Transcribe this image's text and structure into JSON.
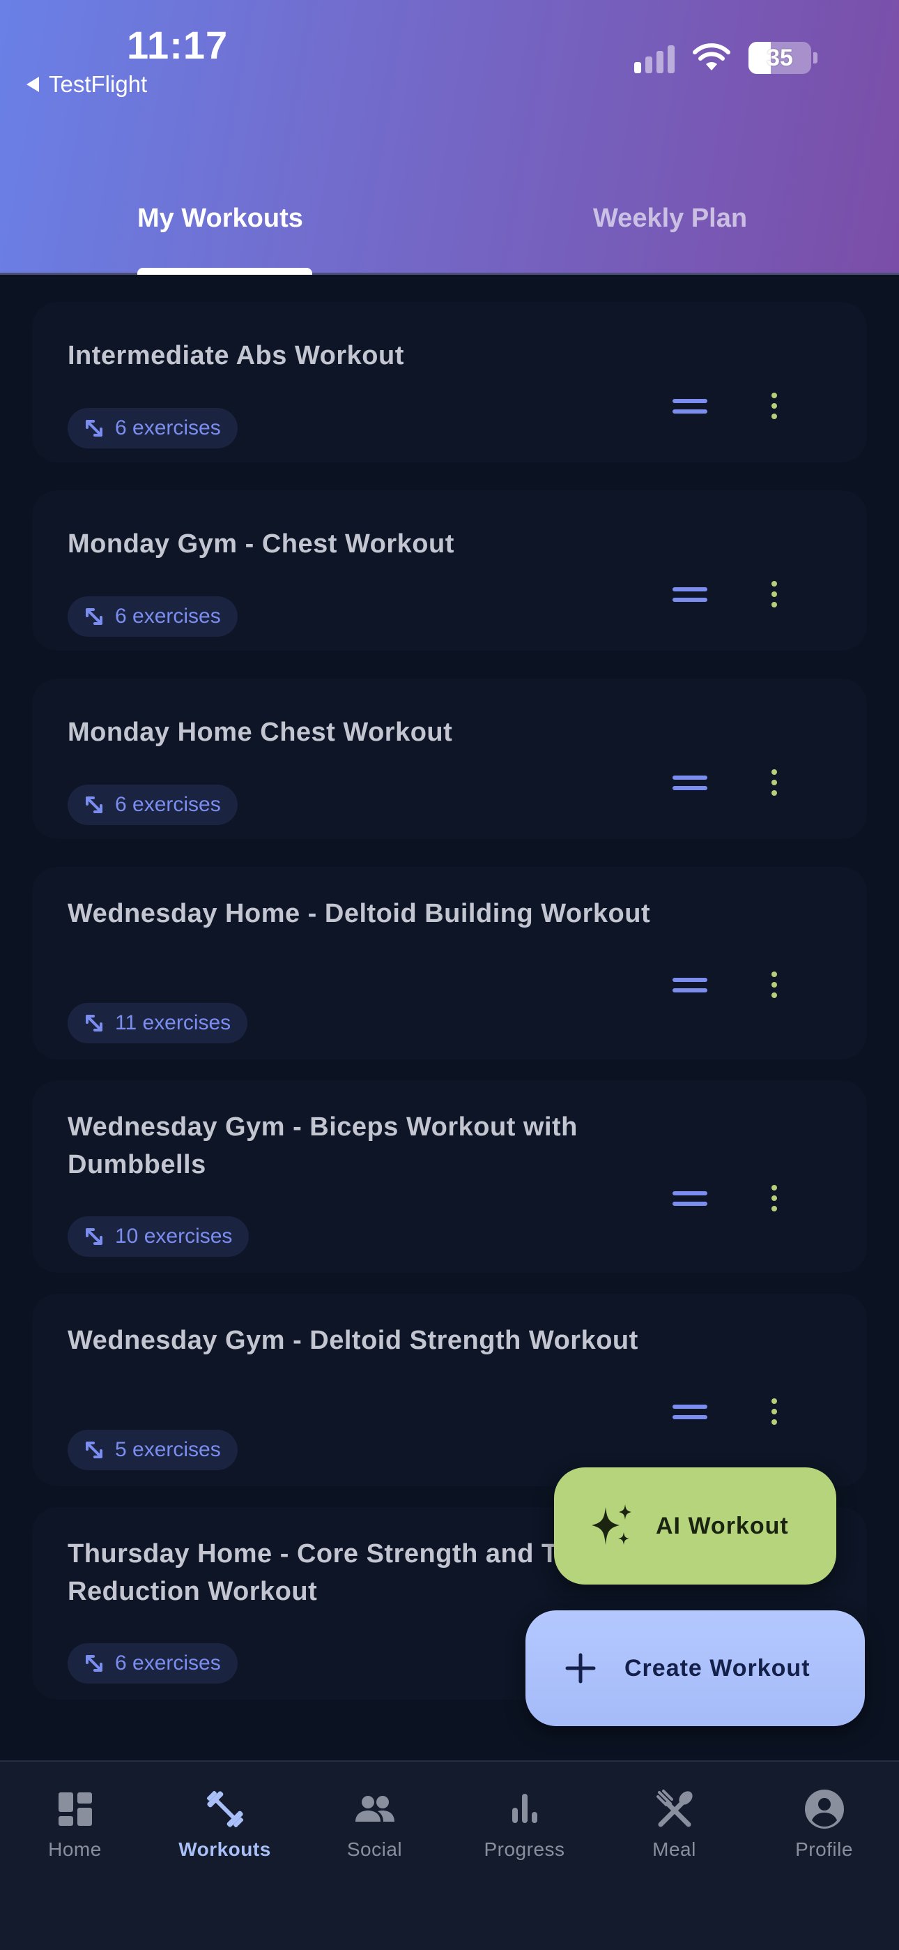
{
  "status_bar": {
    "time": "11:17",
    "back_label": "TestFlight",
    "battery": "35",
    "battery_level_percent": 35
  },
  "tabs": [
    {
      "label": "My Workouts",
      "active": true
    },
    {
      "label": "Weekly Plan",
      "active": false
    }
  ],
  "workouts": [
    {
      "title": "Intermediate Abs Workout",
      "exercises": "6 exercises"
    },
    {
      "title": "Monday Gym - Chest Workout",
      "exercises": "6 exercises"
    },
    {
      "title": "Monday Home Chest Workout",
      "exercises": "6 exercises"
    },
    {
      "title": "Wednesday Home - Deltoid Building Workout",
      "exercises": "11 exercises"
    },
    {
      "title": "Wednesday Gym - Biceps Workout with Dumbbells",
      "exercises": "10 exercises"
    },
    {
      "title": "Wednesday Gym - Deltoid Strength Workout",
      "exercises": "5 exercises"
    },
    {
      "title": "Thursday Home - Core Strength and Tummy Reduction Workout",
      "exercises": "6 exercises"
    }
  ],
  "fab": {
    "ai_label": "AI Workout",
    "create_label": "Create Workout"
  },
  "bottom_nav": [
    {
      "label": "Home",
      "icon": "dashboard-icon",
      "active": false
    },
    {
      "label": "Workouts",
      "icon": "dumbbell-icon",
      "active": true
    },
    {
      "label": "Social",
      "icon": "people-icon",
      "active": false
    },
    {
      "label": "Progress",
      "icon": "bar-chart-icon",
      "active": false
    },
    {
      "label": "Meal",
      "icon": "utensils-icon",
      "active": false
    },
    {
      "label": "Profile",
      "icon": "account-circle-icon",
      "active": false
    }
  ],
  "colors": {
    "header_gradient_start": "#6a80e6",
    "header_gradient_end": "#7a4ea8",
    "background": "#0b1322",
    "accent_blue": "#7b8ef0",
    "accent_green": "#b6d47c",
    "fab_create": "#aec3fd"
  }
}
